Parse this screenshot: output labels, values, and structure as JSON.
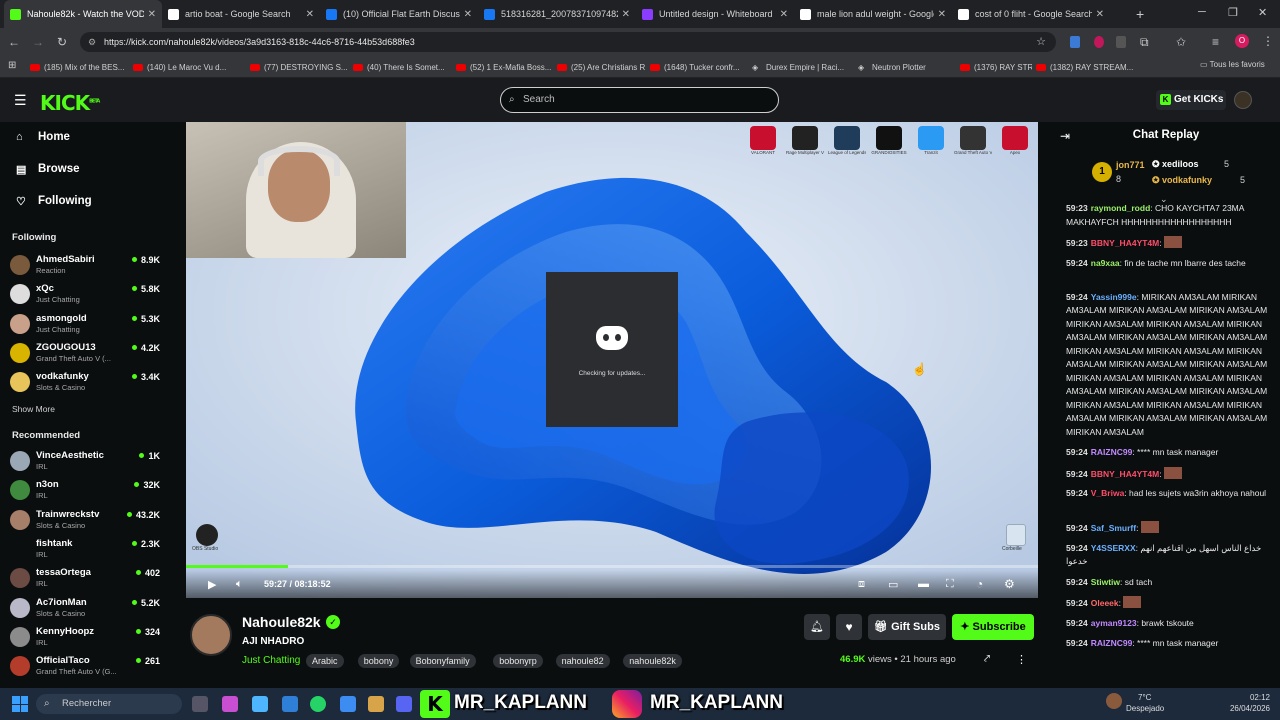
{
  "browser": {
    "tabs": [
      {
        "title": "Nahoule82k - Watch the VOD o",
        "active": true,
        "favicon": "kick-icon",
        "color": "#53fc18"
      },
      {
        "title": "artio boat - Google Search",
        "favicon": "google-icon",
        "color": "#ffffff"
      },
      {
        "title": "(10) Official Flat Earth Discussio",
        "favicon": "facebook-icon",
        "color": "#1877f2"
      },
      {
        "title": "518316281_20078371097482(",
        "favicon": "facebook-icon",
        "color": "#1877f2"
      },
      {
        "title": "Untitled design - Whiteboard",
        "favicon": "canva-icon",
        "color": "#8b3dff"
      },
      {
        "title": "male lion adul weight - Google",
        "favicon": "google-icon",
        "color": "#ffffff"
      },
      {
        "title": "cost of 0 fliht - Google Search",
        "favicon": "google-icon",
        "color": "#ffffff"
      }
    ],
    "new_tab": "+",
    "url": "https://kick.com/nahoule82k/videos/3a9d3163-818c-44c6-8716-44b53d688fe3",
    "bookmarks": [
      "(185) Mix of the BES...",
      "(140) Le Maroc Vu d...",
      "(77) DESTROYING S...",
      "(40) There Is Somet...",
      "(52) 1 Ex-Mafia Boss...",
      "(25) Are Christians R...",
      "(1648) Tucker confr...",
      "Durex Empire | Raci...",
      "Neutron Plotter",
      "(1376) RAY STREAM...",
      "(1382) RAY STREAM..."
    ],
    "all_bookmarks": "Tous les favoris"
  },
  "kick": {
    "logo": "KICK",
    "logo_badge": "BETA",
    "search_placeholder": "Search",
    "get_kicks": "Get KICKs"
  },
  "sidebar": {
    "nav": [
      {
        "label": "Home",
        "icon": "home-icon"
      },
      {
        "label": "Browse",
        "icon": "browse-icon"
      },
      {
        "label": "Following",
        "icon": "heart-icon"
      }
    ],
    "following_title": "Following",
    "following": [
      {
        "name": "AhmedSabiri",
        "category": "Reaction",
        "viewers": "8.9K",
        "color": "#7a5a3c"
      },
      {
        "name": "xQc",
        "category": "Just Chatting",
        "viewers": "5.8K",
        "color": "#dddddd"
      },
      {
        "name": "asmongold",
        "category": "Just Chatting",
        "viewers": "5.3K",
        "color": "#c9a089"
      },
      {
        "name": "ZGOUGOU13",
        "category": "Grand Theft Auto V (...",
        "viewers": "4.2K",
        "color": "#d8b400"
      },
      {
        "name": "vodkafunky",
        "category": "Slots & Casino",
        "viewers": "3.4K",
        "color": "#e7c55a"
      }
    ],
    "show_more": "Show More",
    "recommended_title": "Recommended",
    "recommended": [
      {
        "name": "VinceAesthetic",
        "category": "IRL",
        "viewers": "1K",
        "color": "#9aa7b4"
      },
      {
        "name": "n3on",
        "category": "IRL",
        "viewers": "32K",
        "color": "#3f8a3f"
      },
      {
        "name": "Trainwreckstv",
        "category": "Slots & Casino",
        "viewers": "43.2K",
        "color": "#a67f6b"
      },
      {
        "name": "fishtank",
        "category": "IRL",
        "viewers": "2.3K",
        "color": "#0b0e0f"
      },
      {
        "name": "tessaOrtega",
        "category": "IRL",
        "viewers": "402",
        "color": "#6b4b44"
      },
      {
        "name": "Ac7ionMan",
        "category": "Slots & Casino",
        "viewers": "5.2K",
        "color": "#b8b8c8"
      },
      {
        "name": "KennyHoopz",
        "category": "IRL",
        "viewers": "324",
        "color": "#8b8b8b"
      },
      {
        "name": "OfficialTaco",
        "category": "Grand Theft Auto V (G...",
        "viewers": "261",
        "color": "#b43c2a"
      }
    ]
  },
  "video": {
    "discord_status": "Checking for updates...",
    "current_time": "59:27",
    "duration": "08:18:52",
    "progress": 0.12,
    "desktop_icons": [
      "VALORANT",
      "Rage Multiplayer V Assistance",
      "League of Legends",
      "GRANDIOSITIES",
      "Tranzit",
      "Grand Theft Auto V Enhanced",
      "Apex"
    ],
    "desktop_icons_bottom": [
      "OBS Studio",
      "Corbeille"
    ]
  },
  "streamer": {
    "name": "Nahoule82k",
    "title": "AJI NHADRO",
    "category": "Just Chatting",
    "tags": [
      "Arabic",
      "bobony",
      "Bobonyfamily",
      "bobonyrp",
      "nahoule82",
      "nahoule82k"
    ],
    "views": "46.9K",
    "views_label": "views",
    "age": "21 hours ago",
    "gift_subs": "Gift Subs",
    "subscribe": "Subscribe"
  },
  "chat": {
    "title": "Chat Replay",
    "top_gifters": [
      {
        "rank": "1",
        "name": "jon771",
        "count": "8"
      },
      {
        "name": "xediloos",
        "count": "5"
      },
      {
        "name": "vodkafunky",
        "count": "5"
      }
    ],
    "messages": [
      {
        "time": "59:23",
        "user": "raymond_rodd",
        "color": "#9bf06a",
        "text": "CHO KAYCHTA7 23MA MAKHAYFCH HHHHHHHHHHHHHHHHHH"
      },
      {
        "time": "59:23",
        "user": "BBNY_HA4YT4M",
        "color": "#ff4d6a",
        "text": ""
      },
      {
        "time": "59:24",
        "user": "na9xaa",
        "color": "#9bf06a",
        "text": "fin de tache mn lbarre des tache"
      },
      {
        "time": "59:24",
        "user": "Yassin999e",
        "color": "#6ab0ff",
        "text": "MIRIKAN AM3ALAM MIRIKAN AM3ALAM MIRIKAN AM3ALAM MIRIKAN AM3ALAM MIRIKAN AM3ALAM MIRIKAN AM3ALAM MIRIKAN AM3ALAM MIRIKAN AM3ALAM MIRIKAN AM3ALAM MIRIKAN AM3ALAM MIRIKAN AM3ALAM MIRIKAN AM3ALAM MIRIKAN AM3ALAM MIRIKAN AM3ALAM MIRIKAN AM3ALAM MIRIKAN AM3ALAM MIRIKAN AM3ALAM MIRIKAN AM3ALAM MIRIKAN AM3ALAM MIRIKAN AM3ALAM MIRIKAN AM3ALAM MIRIKAN AM3ALAM MIRIKAN AM3ALAM MIRIKAN AM3ALAM MIRIKAN AM3ALAM"
      },
      {
        "time": "59:24",
        "user": "RAIZNC99",
        "color": "#c08aff",
        "text": "**** mn task manager"
      },
      {
        "time": "59:24",
        "user": "BBNY_HA4YT4M",
        "color": "#ff4d6a",
        "text": ""
      },
      {
        "time": "59:24",
        "user": "V_Briwa",
        "color": "#ff4d6a",
        "text": "had les sujets wa3rin akhoya nahoul"
      },
      {
        "time": "59:24",
        "user": "Saf_Smurff",
        "color": "#6ab0ff",
        "text": ""
      },
      {
        "time": "59:24",
        "user": "Y4SSERXX",
        "color": "#6ab0ff",
        "text": "خداع الناس اسهل من اقناعهم انهم خدعوا"
      },
      {
        "time": "59:24",
        "user": "Stiwtiw",
        "color": "#9bf06a",
        "text": "sd tach"
      },
      {
        "time": "59:24",
        "user": "Oleeek",
        "color": "#ff6a6a",
        "text": ""
      },
      {
        "time": "59:24",
        "user": "ayman9123",
        "color": "#c08aff",
        "text": "brawk tskoute"
      },
      {
        "time": "59:24",
        "user": "RAIZNC99",
        "color": "#c08aff",
        "text": "**** mn task manager"
      }
    ]
  },
  "taskbar": {
    "search_placeholder": "Rechercher",
    "overlay_text": "MR_KAPLANN",
    "weather_temp": "7°C",
    "weather_desc": "Despejado",
    "time": "02:12",
    "date": "26/04/2026"
  }
}
